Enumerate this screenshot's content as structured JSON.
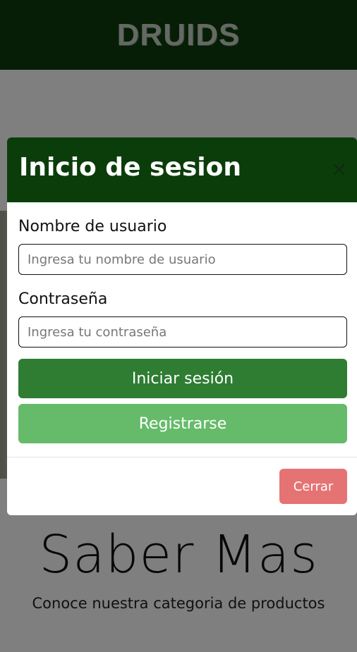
{
  "header": {
    "brand": "DRUIDS"
  },
  "hero": {
    "title": "Saber Mas",
    "subtitle": "Conoce nuestra categoria de productos"
  },
  "modal": {
    "title": "Inicio de sesion",
    "close_icon": "close-icon",
    "username_label": "Nombre de usuario",
    "username_placeholder": "Ingresa tu nombre de usuario",
    "password_label": "Contraseña",
    "password_placeholder": "Ingresa tu contraseña",
    "login_button": "Iniciar sesión",
    "register_button": "Registrarse",
    "close_button": "Cerrar"
  },
  "colors": {
    "header_bg": "#0b3d0b",
    "primary": "#2e7d32",
    "secondary": "#66bb6a",
    "danger": "#e57373"
  }
}
